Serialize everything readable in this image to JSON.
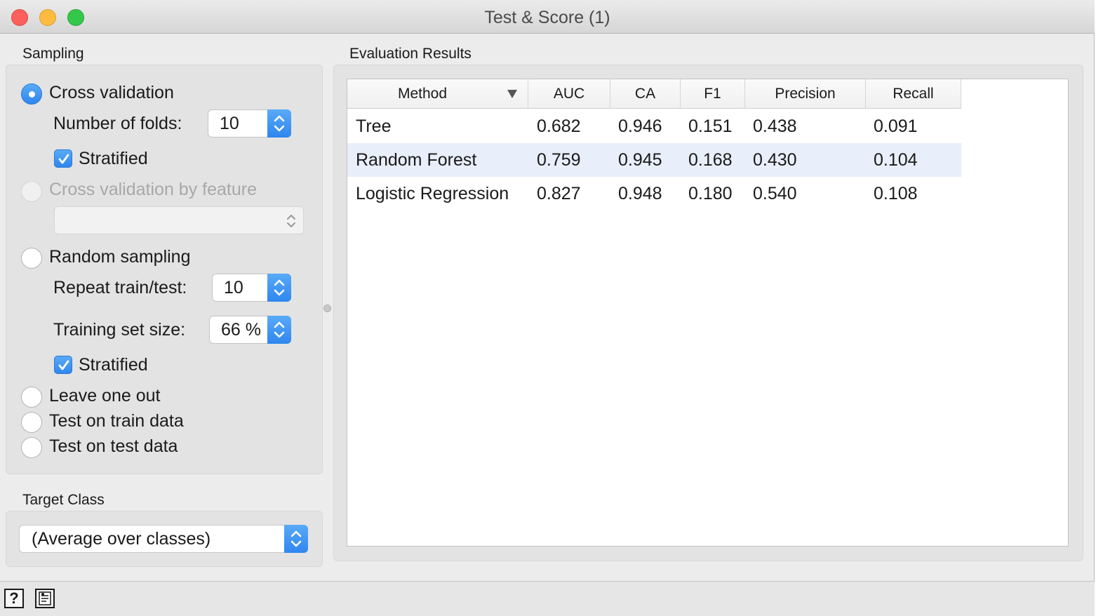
{
  "window": {
    "title": "Test & Score (1)"
  },
  "sampling": {
    "section_label": "Sampling",
    "cross_validation": {
      "label": "Cross validation",
      "selected": true,
      "folds_label": "Number of folds:",
      "folds_value": "10",
      "stratified_label": "Stratified",
      "stratified_checked": true
    },
    "cross_validation_by_feature": {
      "label": "Cross validation by feature",
      "enabled": false,
      "feature_value": ""
    },
    "random_sampling": {
      "label": "Random sampling",
      "selected": false,
      "repeat_label": "Repeat train/test:",
      "repeat_value": "10",
      "train_size_label": "Training set size:",
      "train_size_value": "66 %",
      "stratified_label": "Stratified",
      "stratified_checked": true
    },
    "leave_one_out": {
      "label": "Leave one out",
      "selected": false
    },
    "test_on_train": {
      "label": "Test on train data",
      "selected": false
    },
    "test_on_test": {
      "label": "Test on test data",
      "selected": false
    }
  },
  "target_class": {
    "section_label": "Target Class",
    "value": "(Average over classes)"
  },
  "results": {
    "section_label": "Evaluation Results",
    "columns": [
      "Method",
      "AUC",
      "CA",
      "F1",
      "Precision",
      "Recall"
    ],
    "sort_column": "Method",
    "rows": [
      {
        "method": "Tree",
        "auc": "0.682",
        "ca": "0.946",
        "f1": "0.151",
        "precision": "0.438",
        "recall": "0.091",
        "selected": false
      },
      {
        "method": "Random Forest",
        "auc": "0.759",
        "ca": "0.945",
        "f1": "0.168",
        "precision": "0.430",
        "recall": "0.104",
        "selected": true
      },
      {
        "method": "Logistic Regression",
        "auc": "0.827",
        "ca": "0.948",
        "f1": "0.180",
        "precision": "0.540",
        "recall": "0.108",
        "selected": false
      }
    ]
  },
  "bottom_bar": {
    "help_icon": "question-mark-icon",
    "report_icon": "report-icon",
    "help_glyph": "?"
  },
  "colors": {
    "accent": "#2f86ee",
    "selection_row": "#e8eefa",
    "close": "#fc605c",
    "minimize": "#fdbc40",
    "maximize": "#34c84a"
  }
}
